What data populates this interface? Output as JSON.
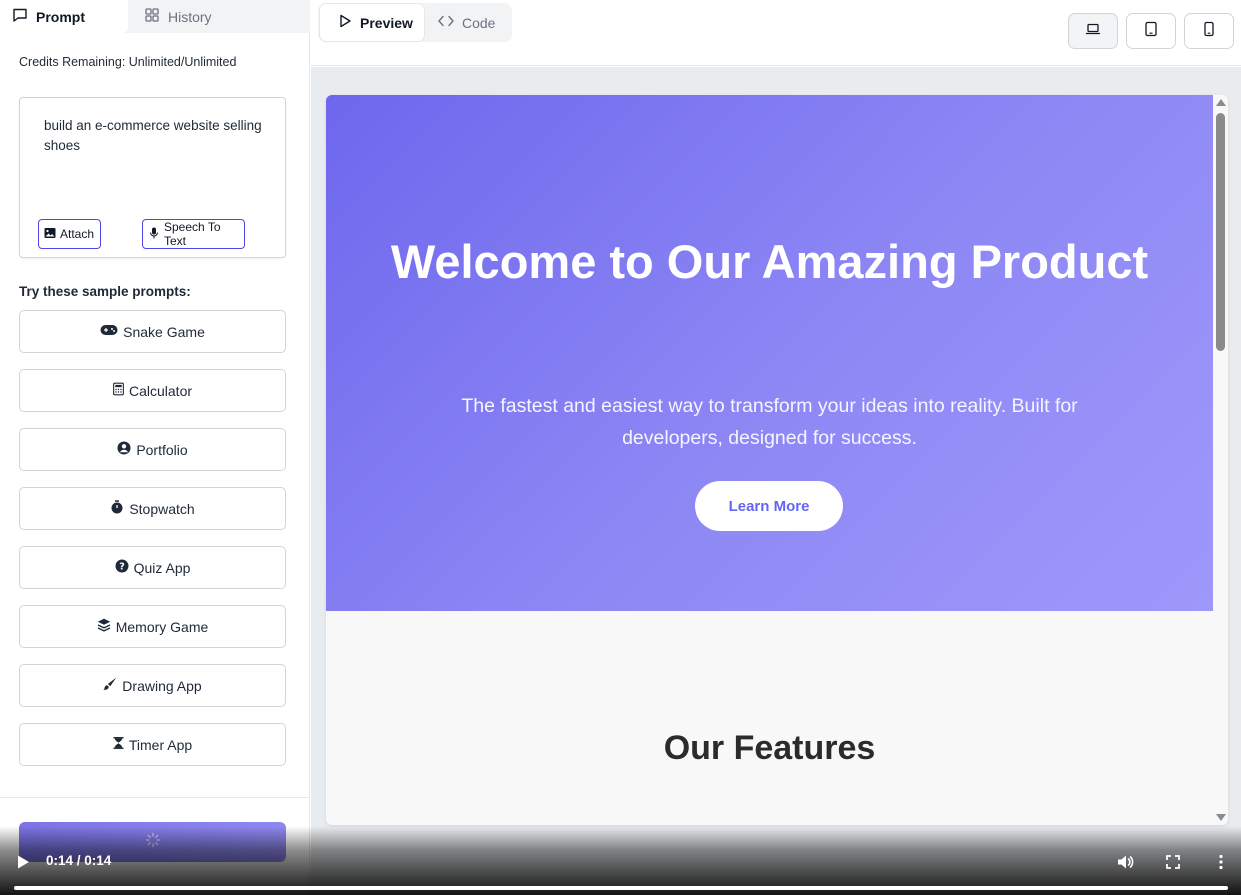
{
  "sidebar": {
    "tabs": [
      {
        "label": "Prompt",
        "icon": "chat-icon",
        "active": true
      },
      {
        "label": "History",
        "icon": "grid-icon",
        "active": false
      }
    ],
    "credits": "Credits Remaining: Unlimited/Unlimited",
    "prompt": {
      "value": "build an e-commerce website selling shoes",
      "attach_label": "Attach",
      "speech_label": "Speech To Text"
    },
    "samples_title": "Try these sample prompts:",
    "samples": [
      {
        "label": "Snake Game",
        "icon": "gamepad-icon"
      },
      {
        "label": "Calculator",
        "icon": "calculator-icon"
      },
      {
        "label": "Portfolio",
        "icon": "user-circle-icon"
      },
      {
        "label": "Stopwatch",
        "icon": "stopwatch-icon"
      },
      {
        "label": "Quiz App",
        "icon": "question-circle-icon"
      },
      {
        "label": "Memory Game",
        "icon": "layers-icon"
      },
      {
        "label": "Drawing App",
        "icon": "paintbrush-icon"
      },
      {
        "label": "Timer App",
        "icon": "hourglass-icon"
      }
    ]
  },
  "toolbar": {
    "preview_label": "Preview",
    "code_label": "Code",
    "devices": [
      "laptop-icon",
      "tablet-icon",
      "phone-icon"
    ]
  },
  "preview": {
    "hero_title": "Welcome to Our Amazing Product",
    "hero_subtitle": "The fastest and easiest way to transform your ideas into reality. Built for developers, designed for success.",
    "cta_label": "Learn More",
    "features_title": "Our Features"
  },
  "video": {
    "time": "0:14 / 0:14",
    "progress": 1.0
  },
  "colors": {
    "accent": "#6366f1",
    "hero_start": "#6e67ed",
    "hero_end": "#9f98fb"
  }
}
